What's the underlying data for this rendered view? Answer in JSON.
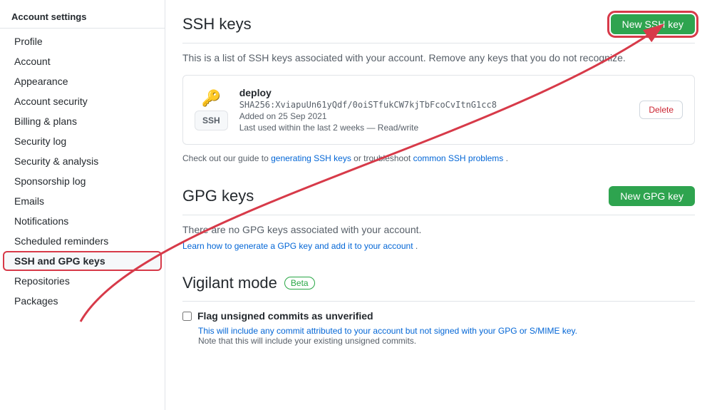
{
  "sidebar": {
    "header": "Account settings",
    "items": [
      {
        "label": "Profile",
        "active": false
      },
      {
        "label": "Account",
        "active": false
      },
      {
        "label": "Appearance",
        "active": false
      },
      {
        "label": "Account security",
        "active": false
      },
      {
        "label": "Billing & plans",
        "active": false
      },
      {
        "label": "Security log",
        "active": false
      },
      {
        "label": "Security & analysis",
        "active": false
      },
      {
        "label": "Sponsorship log",
        "active": false
      },
      {
        "label": "Emails",
        "active": false
      },
      {
        "label": "Notifications",
        "active": false
      },
      {
        "label": "Scheduled reminders",
        "active": false
      },
      {
        "label": "SSH and GPG keys",
        "active": true
      },
      {
        "label": "Repositories",
        "active": false
      },
      {
        "label": "Packages",
        "active": false
      }
    ]
  },
  "ssh_section": {
    "title": "SSH keys",
    "new_button": "New SSH key",
    "info_text": "This is a list of SSH keys associated with your account. Remove any keys that you do not recognize.",
    "keys": [
      {
        "name": "deploy",
        "hash": "SHA256:XviapuUn61yQdf/0oiSTfukCW7kjTbFcoCvItnG1cc8",
        "added": "Added on 25 Sep 2021",
        "last_used": "Last used within the last 2 weeks — Read/write",
        "badge": "SSH",
        "delete_label": "Delete"
      }
    ],
    "guide_text": "Check out our guide to",
    "guide_link1": "generating SSH keys",
    "guide_middle": "or troubleshoot",
    "guide_link2": "common SSH problems",
    "guide_end": "."
  },
  "gpg_section": {
    "title": "GPG keys",
    "new_button": "New GPG key",
    "empty_text": "There are no GPG keys associated with your account.",
    "learn_link": "Learn how to generate a GPG key and add it to your account",
    "learn_end": "."
  },
  "vigilant_section": {
    "title": "Vigilant mode",
    "beta_label": "Beta",
    "checkbox_label": "Flag unsigned commits as unverified",
    "checkbox_desc": "This will include any commit attributed to your account but not signed with your GPG or S/MIME key.",
    "checkbox_note": "Note that this will include your existing unsigned commits."
  }
}
